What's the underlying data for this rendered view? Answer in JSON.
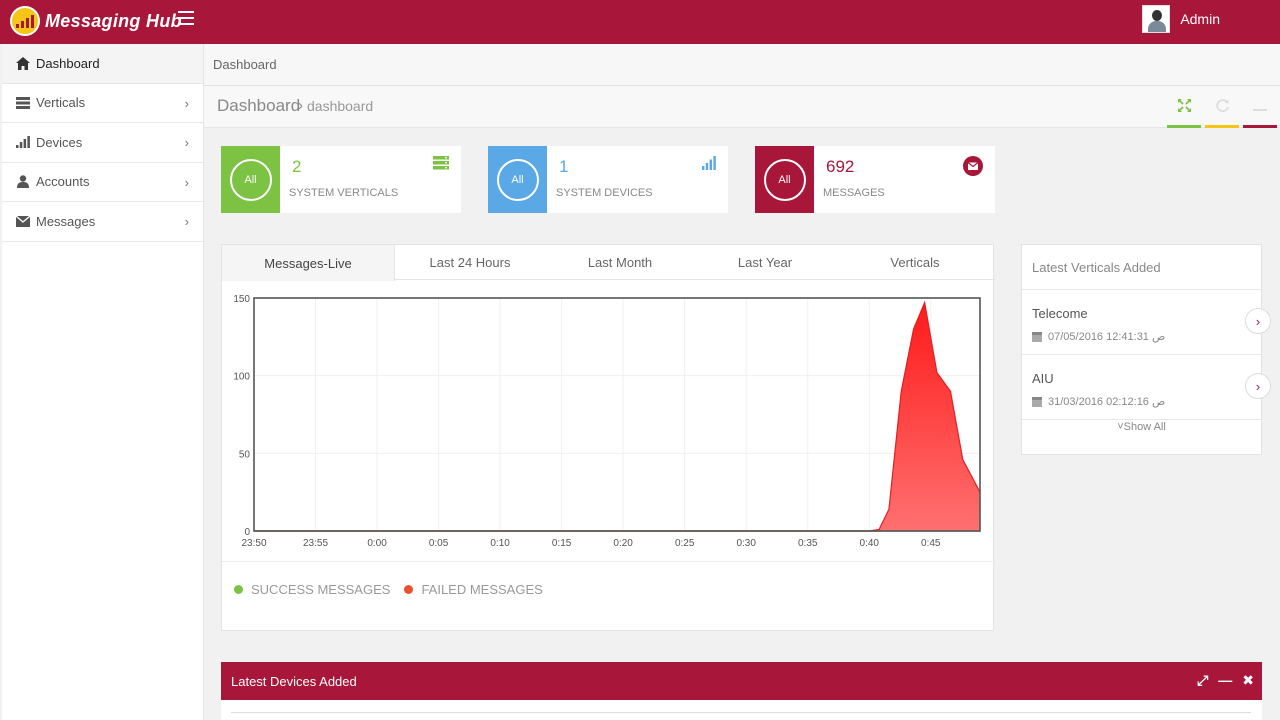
{
  "app": {
    "name": "Messaging Hub"
  },
  "user": {
    "name": "Admin"
  },
  "sidebar": {
    "items": [
      {
        "label": "Dashboard"
      },
      {
        "label": "Verticals"
      },
      {
        "label": "Devices"
      },
      {
        "label": "Accounts"
      },
      {
        "label": "Messages"
      }
    ]
  },
  "breadcrumb": {
    "current": "Dashboard"
  },
  "page_header": {
    "title": "Dashboard",
    "separator": "›",
    "subtitle": "dashboard"
  },
  "header_tools": {
    "expand": "expand-icon",
    "refresh": "refresh-icon",
    "minimize": "minus-icon"
  },
  "stats": [
    {
      "ring_label": "All",
      "value": "2",
      "label": "SYSTEM VERTICALS",
      "color": "#7cc243",
      "value_color": "#7cc243",
      "icon": "server-icon"
    },
    {
      "ring_label": "All",
      "value": "1",
      "label": "SYSTEM DEVICES",
      "color": "#5aa8e6",
      "value_color": "#5aa8e6",
      "icon": "signal-icon"
    },
    {
      "ring_label": "All",
      "value": "692",
      "label": "MESSAGES",
      "color": "#a8163a",
      "value_color": "#a8163a",
      "icon": "envelope-icon"
    }
  ],
  "chart_tabs": [
    "Messages-Live",
    "Last 24 Hours",
    "Last Month",
    "Last Year",
    "Verticals"
  ],
  "chart_data": {
    "type": "area",
    "x": [
      "23:50",
      "23:55",
      "0:00",
      "0:05",
      "0:10",
      "0:15",
      "0:20",
      "0:25",
      "0:30",
      "0:35",
      "0:40",
      "0:45"
    ],
    "ylim": [
      0,
      150
    ],
    "yticks": [
      0,
      50,
      100,
      150
    ],
    "series": [
      {
        "name": "SUCCESS MESSAGES",
        "color": "#7cc243",
        "points": [
          [
            0,
            0
          ],
          [
            50,
            0
          ],
          [
            53,
            0
          ],
          [
            59,
            0
          ]
        ]
      },
      {
        "name": "FAILED MESSAGES",
        "color": "#e85030",
        "points": [
          [
            0,
            0
          ],
          [
            50,
            0
          ],
          [
            50.8,
            1
          ],
          [
            51.6,
            14
          ],
          [
            52.6,
            90
          ],
          [
            53.6,
            130
          ],
          [
            54.5,
            147
          ],
          [
            55.5,
            102
          ],
          [
            56.6,
            90
          ],
          [
            57.6,
            46
          ],
          [
            59,
            25
          ]
        ]
      }
    ],
    "legend": "bottom-left",
    "grid": true
  },
  "latest_verticals": {
    "title": "Latest Verticals Added",
    "items": [
      {
        "name": "Telecome",
        "date": "07/05/2016 12:41:31 ص"
      },
      {
        "name": "AIU",
        "date": "31/03/2016 02:12:16 ص"
      }
    ],
    "show_all": "˅Show All"
  },
  "latest_devices": {
    "title": "Latest Devices Added"
  }
}
